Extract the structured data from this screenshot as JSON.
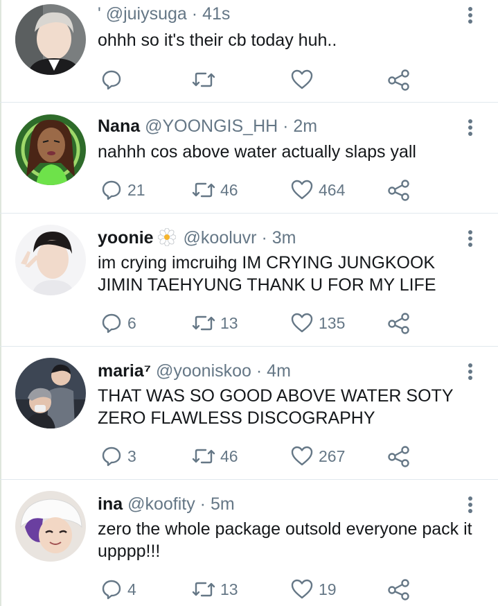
{
  "tweets": [
    {
      "name": "",
      "handle": "' @juiysuga",
      "dot": "·",
      "time": "41s",
      "text": "ohhh so it's their cb today huh..",
      "reply_count": "",
      "retweet_count": "",
      "like_count": ""
    },
    {
      "name": "Nana",
      "handle": "@YOONGIS_HH",
      "dot": "·",
      "time": "2m",
      "text": "nahhh cos above water actually slaps yall",
      "reply_count": "21",
      "retweet_count": "46",
      "like_count": "464"
    },
    {
      "name": "yoonie",
      "handle": "@kooluvr",
      "dot": "·",
      "time": "3m",
      "text": "im crying imcruihg IM CRYING JUNGKOOK JIMIN TAEHYUNG THANK U FOR MY LIFE",
      "reply_count": "6",
      "retweet_count": "13",
      "like_count": "135"
    },
    {
      "name": "maria⁷",
      "handle": "@yooniskoo",
      "dot": "·",
      "time": "4m",
      "text": "THAT WAS SO GOOD ABOVE WATER SOTY ZERO FLAWLESS DISCOGRAPHY",
      "reply_count": "3",
      "retweet_count": "46",
      "like_count": "267"
    },
    {
      "name": "ina",
      "handle": "@koofity",
      "dot": "·",
      "time": "5m",
      "text": "zero the whole package outsold everyone pack it upppp!!!",
      "reply_count": "4",
      "retweet_count": "13",
      "like_count": "19"
    }
  ],
  "icons": {
    "reply": "reply-icon",
    "retweet": "retweet-icon",
    "like": "heart-icon",
    "share": "share-icon",
    "more": "more-vertical-icon",
    "badge": "flower-icon"
  },
  "colors": {
    "text": "#14171a",
    "muted": "#657786",
    "divider": "#e1e8ed",
    "flower_center": "#f6b52e"
  }
}
